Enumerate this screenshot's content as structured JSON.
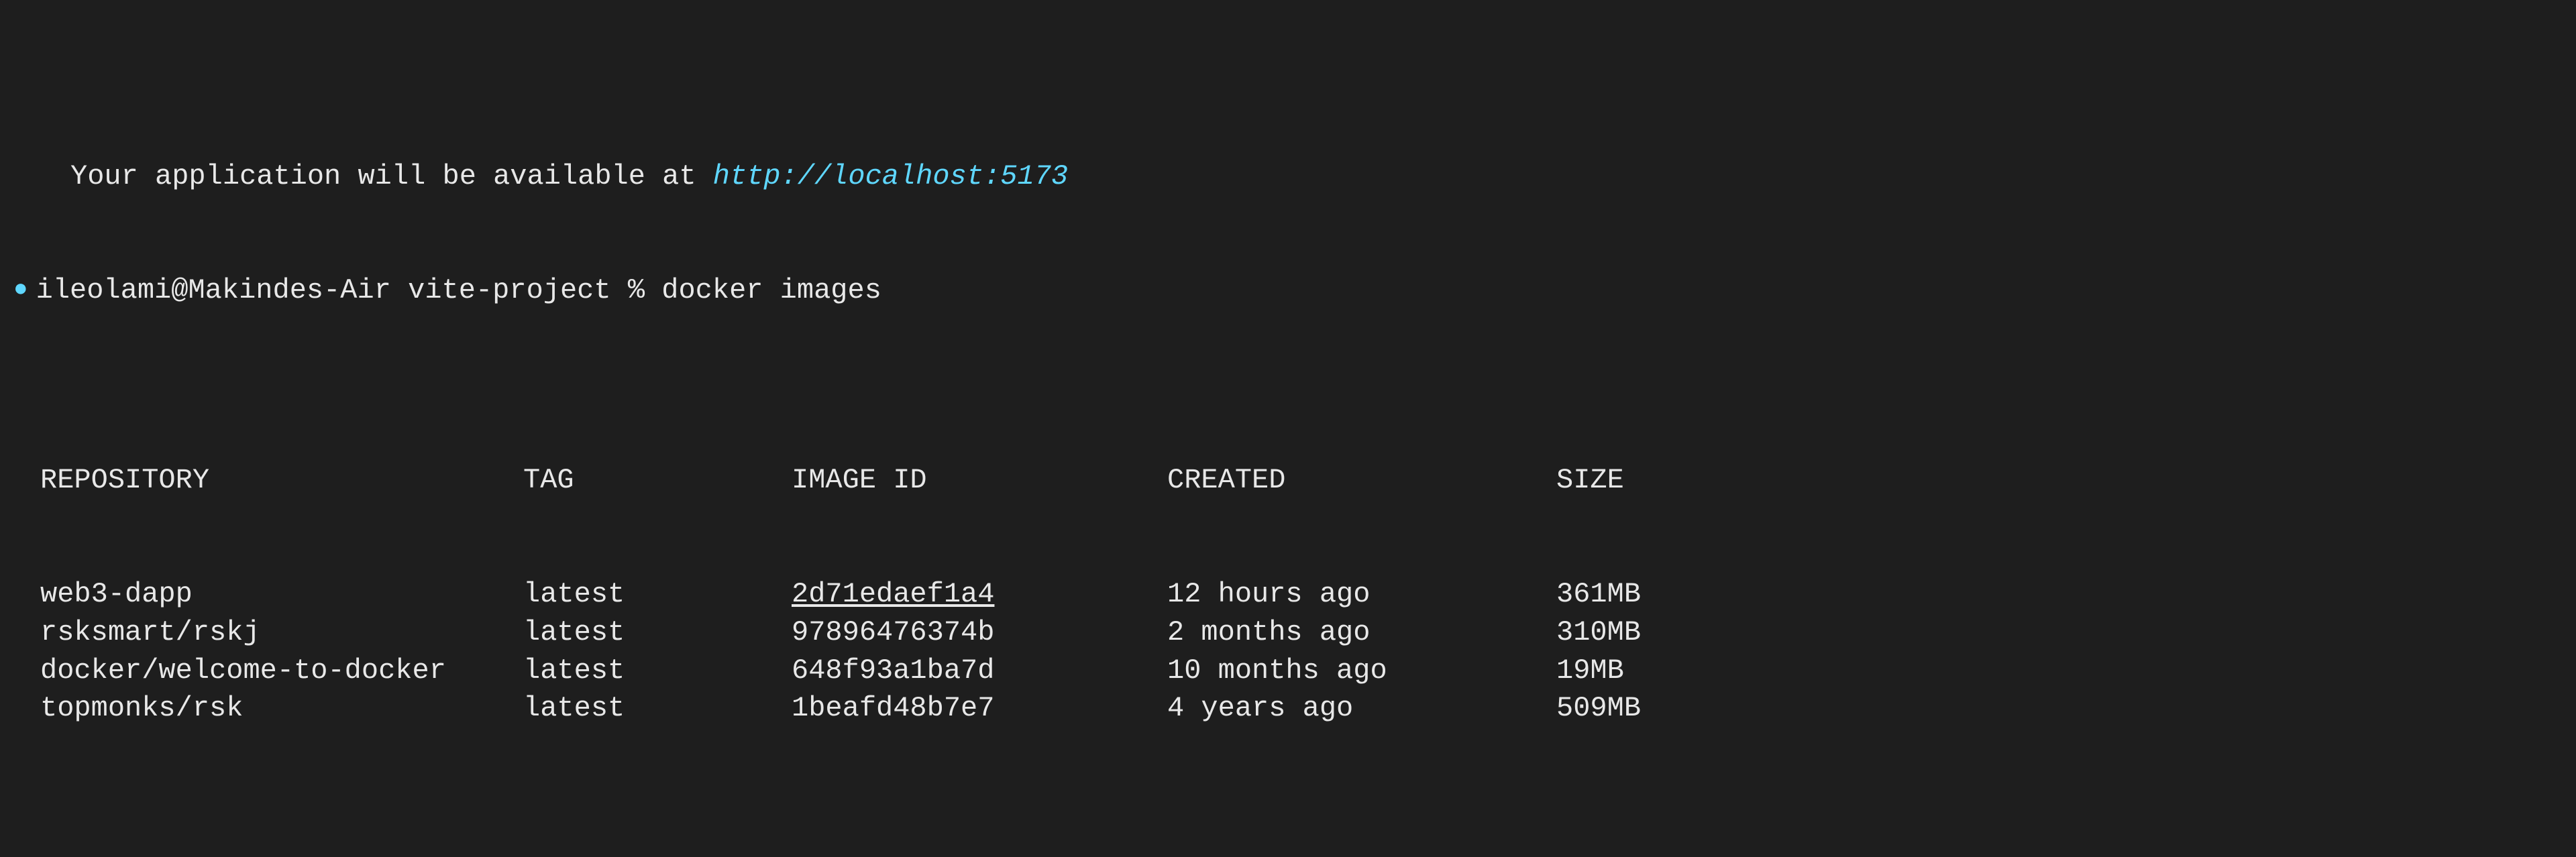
{
  "partial_top": {
    "text_prefix": "Your application will be available at ",
    "url": "http://localhost:5173"
  },
  "prompt": {
    "user": "ileolami",
    "host": "Makindes-Air",
    "path": "vite-project",
    "symbol": "%",
    "command": "docker images"
  },
  "table": {
    "headers": {
      "repository": "REPOSITORY",
      "tag": "TAG",
      "image_id": "IMAGE ID",
      "created": "CREATED",
      "size": "SIZE"
    },
    "rows": [
      {
        "repository": "web3-dapp",
        "tag": "latest",
        "image_id": "2d71edaef1a4",
        "image_id_underlined": true,
        "created": "12 hours ago",
        "size": "361MB"
      },
      {
        "repository": "rsksmart/rskj",
        "tag": "latest",
        "image_id": "97896476374b",
        "image_id_underlined": false,
        "created": "2 months ago",
        "size": "310MB"
      },
      {
        "repository": "docker/welcome-to-docker",
        "tag": "latest",
        "image_id": "648f93a1ba7d",
        "image_id_underlined": false,
        "created": "10 months ago",
        "size": "19MB"
      },
      {
        "repository": "topmonks/rsk",
        "tag": "latest",
        "image_id": "1beafd48b7e7",
        "image_id_underlined": false,
        "created": "4 years ago",
        "size": "509MB"
      }
    ]
  }
}
